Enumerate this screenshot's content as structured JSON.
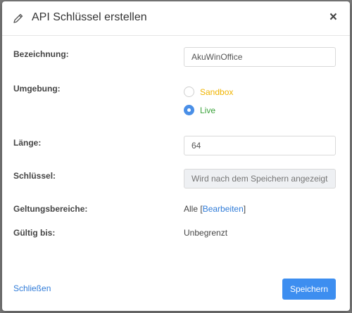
{
  "dialog": {
    "title": "API Schlüssel erstellen",
    "close_symbol": "×",
    "icon": "pencil-icon"
  },
  "form": {
    "name": {
      "label": "Bezeichnung:",
      "value": "AkuWinOffice"
    },
    "environment": {
      "label": "Umgebung:",
      "options": [
        {
          "label": "Sandbox",
          "color": "#f0b400",
          "checked": false
        },
        {
          "label": "Live",
          "color": "#3aa23a",
          "checked": true
        }
      ]
    },
    "length": {
      "label": "Länge:",
      "value": "64"
    },
    "key": {
      "label": "Schlüssel:",
      "placeholder": "Wird nach dem Speichern angezeigt..."
    },
    "scopes": {
      "label": "Geltungsbereiche:",
      "value": "Alle",
      "bracket_open": "[",
      "edit_link": "Bearbeiten",
      "bracket_close": "]"
    },
    "valid_until": {
      "label": "Gültig bis:",
      "value": "Unbegrenzt"
    }
  },
  "footer": {
    "close_label": "Schließen",
    "save_label": "Speichern"
  },
  "colors": {
    "primary": "#3d8ef0",
    "link": "#2f7bd8",
    "sandbox": "#f0b400",
    "live": "#3aa23a"
  }
}
